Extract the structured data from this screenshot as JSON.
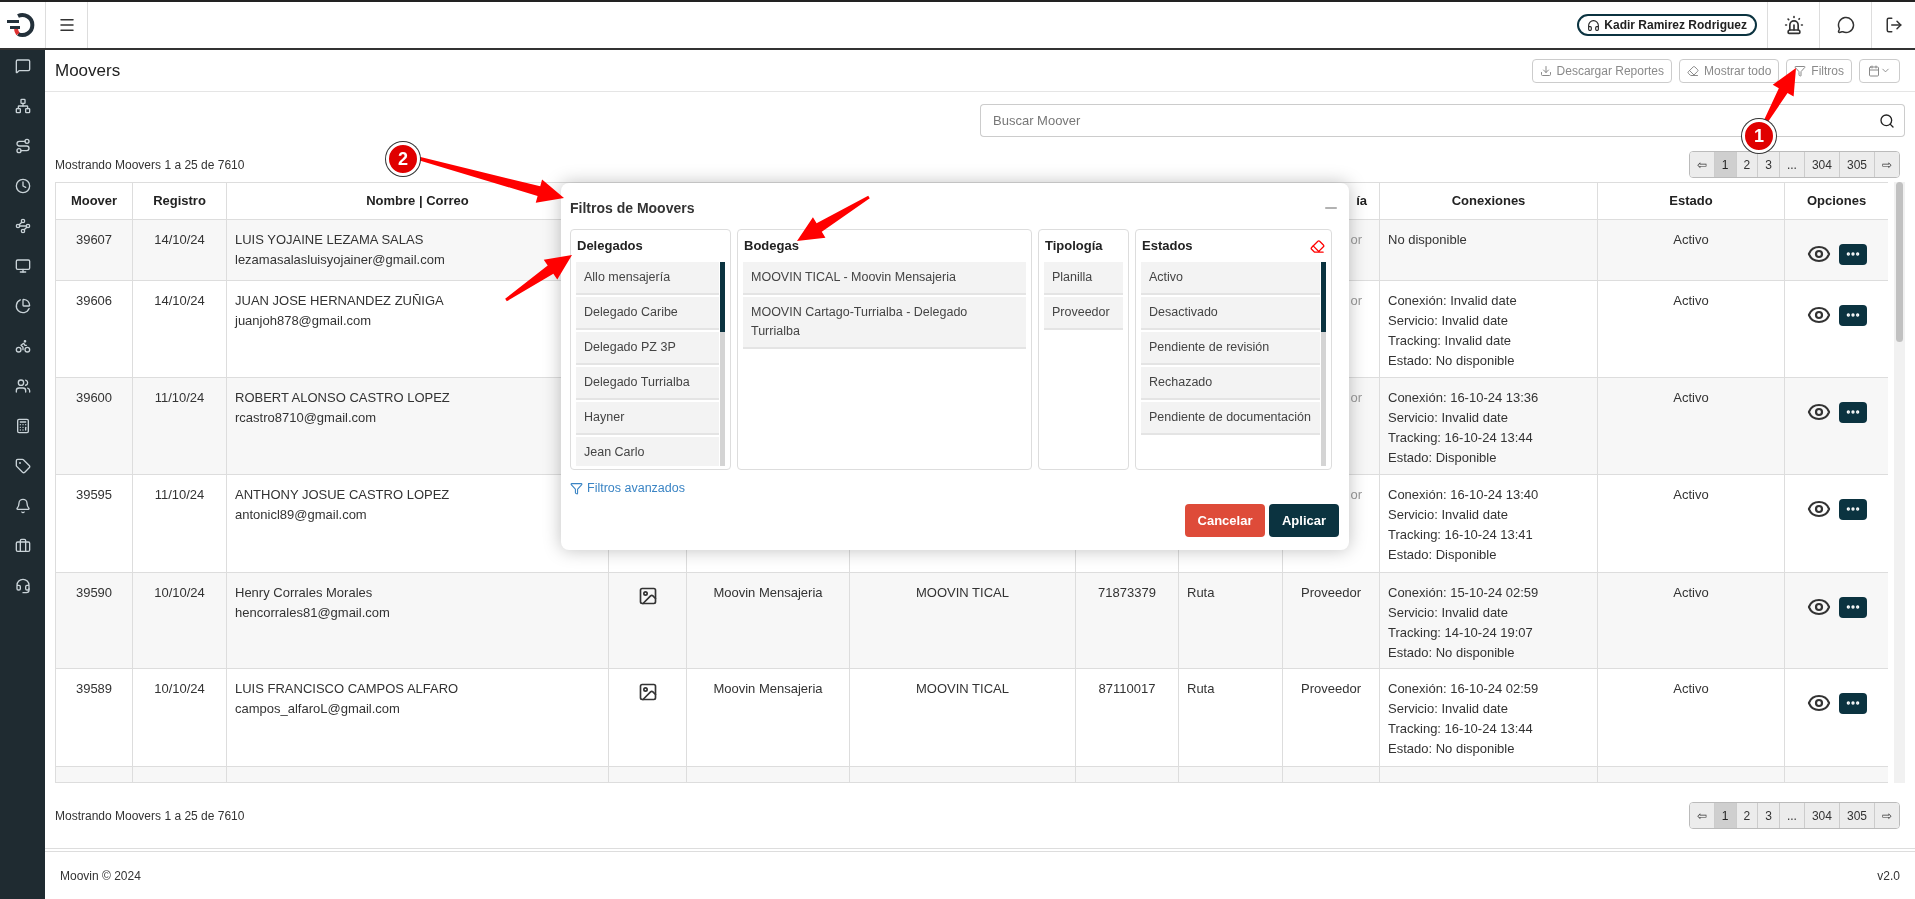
{
  "header": {
    "user": "Kadir Ramirez Rodriguez"
  },
  "page": {
    "title": "Moovers",
    "toolbar": [
      {
        "kind": "download",
        "label": "Descargar Reportes"
      },
      {
        "kind": "eraser",
        "label": "Mostrar todo"
      },
      {
        "kind": "filter",
        "label": "Filtros"
      },
      {
        "kind": "calendar"
      }
    ],
    "search_placeholder": "Buscar Moover"
  },
  "summary_top": "Mostrando Moovers 1 a 25 de 7610",
  "pagination_top": [
    {
      "label": "⇦",
      "selected": false
    },
    {
      "label": "1",
      "selected": true
    },
    {
      "label": "2",
      "selected": false
    },
    {
      "label": "3",
      "selected": false
    },
    {
      "label": "...",
      "selected": false
    },
    {
      "label": "304",
      "selected": false
    },
    {
      "label": "305",
      "selected": false
    },
    {
      "label": "⇨",
      "selected": false
    }
  ],
  "table": {
    "columns_left": [
      "Moover",
      "Registro",
      "Nombre | Correo"
    ],
    "columns_right": [
      "ía",
      "Conexiones",
      "Estado",
      "Opciones"
    ],
    "rows": [
      {
        "overlapped": true,
        "moover": "39607",
        "registro": "14/10/24",
        "nombre": "LUIS YOJAINE LEZAMA SALAS",
        "correo": "lezamasalasluisyojainer@gmail.com",
        "tipologia": "or",
        "conexiones": [
          "No disponible"
        ],
        "estado": "Activo"
      },
      {
        "overlapped": true,
        "moover": "39606",
        "registro": "14/10/24",
        "nombre": "JUAN JOSE HERNANDEZ ZUÑIGA",
        "correo": "juanjoh878@gmail.com",
        "tipologia": "or",
        "conexiones": [
          "Conexión: Invalid date",
          "Servicio: Invalid date",
          "Tracking: Invalid date",
          "Estado: No disponible"
        ],
        "estado": "Activo"
      },
      {
        "overlapped": true,
        "moover": "39600",
        "registro": "11/10/24",
        "nombre": "ROBERT ALONSO CASTRO LOPEZ",
        "correo": "rcastro8710@gmail.com",
        "tipologia": "or",
        "conexiones": [
          "Conexión: 16-10-24 13:36",
          "Servicio: Invalid date",
          "Tracking: 16-10-24 13:44",
          "Estado: Disponible"
        ],
        "estado": "Activo"
      },
      {
        "overlapped": true,
        "moover": "39595",
        "registro": "11/10/24",
        "nombre": "ANTHONY JOSUE CASTRO LOPEZ",
        "correo": "antonicl89@gmail.com",
        "tipologia": "or",
        "conexiones": [
          "Conexión: 16-10-24 13:40",
          "Servicio: Invalid date",
          "Tracking: 16-10-24 13:41",
          "Estado: Disponible"
        ],
        "estado": "Activo"
      },
      {
        "overlapped": false,
        "moover": "39590",
        "registro": "10/10/24",
        "nombre": "Henry Corrales Morales",
        "correo": "hencorrales81@gmail.com",
        "photo": true,
        "delegado": "Moovin Mensajeria",
        "bodega": "MOOVIN TICAL",
        "telefono": "71873379",
        "tipo": "Ruta",
        "tipologia": "Proveedor",
        "conexiones": [
          "Conexión: 15-10-24 02:59",
          "Servicio: Invalid date",
          "Tracking: 14-10-24 19:07",
          "Estado: No disponible"
        ],
        "estado": "Activo"
      },
      {
        "overlapped": false,
        "moover": "39589",
        "registro": "10/10/24",
        "nombre": "LUIS FRANCISCO CAMPOS ALFARO",
        "correo": "campos_alfaroL@gmail.com",
        "photo": true,
        "delegado": "Moovin Mensajeria",
        "bodega": "MOOVIN TICAL",
        "telefono": "87110017",
        "tipo": "Ruta",
        "tipologia": "Proveedor",
        "conexiones": [
          "Conexión: 16-10-24 02:59",
          "Servicio: Invalid date",
          "Tracking: 16-10-24 13:44",
          "Estado: No disponible"
        ],
        "estado": "Activo"
      }
    ]
  },
  "summary_bottom": "Mostrando Moovers 1 a 25 de 7610",
  "pagination_bottom": [
    {
      "label": "⇦",
      "selected": false
    },
    {
      "label": "1",
      "selected": true
    },
    {
      "label": "2",
      "selected": false
    },
    {
      "label": "3",
      "selected": false
    },
    {
      "label": "...",
      "selected": false
    },
    {
      "label": "304",
      "selected": false
    },
    {
      "label": "305",
      "selected": false
    },
    {
      "label": "⇨",
      "selected": false
    }
  ],
  "footer": {
    "copyright": "Moovin © 2024",
    "version": "v2.0"
  },
  "filter_modal": {
    "title": "Filtros de Moovers",
    "panels": [
      {
        "title": "Delegados",
        "scrollable": true,
        "clearable": false,
        "items": [
          "Allo mensajería",
          "Delegado Caribe",
          "Delegado PZ 3P",
          "Delegado Turrialba",
          "Hayner",
          "Jean Carlo"
        ]
      },
      {
        "title": "Bodegas",
        "scrollable": false,
        "clearable": false,
        "items": [
          "MOOVIN TICAL - Moovin Mensajeria",
          "MOOVIN Cartago-Turrialba - Delegado Turrialba"
        ]
      },
      {
        "title": "Tipología",
        "scrollable": false,
        "clearable": false,
        "items": [
          "Planilla",
          "Proveedor"
        ]
      },
      {
        "title": "Estados",
        "scrollable": true,
        "clearable": true,
        "items": [
          "Activo",
          "Desactivado",
          "Pendiente de revisión",
          "Rechazado",
          "Pendiente de documentación"
        ]
      }
    ],
    "advanced_link": "Filtros avanzados",
    "cancel": "Cancelar",
    "apply": "Aplicar"
  },
  "annotations": [
    {
      "label": "1"
    },
    {
      "label": "2"
    }
  ]
}
